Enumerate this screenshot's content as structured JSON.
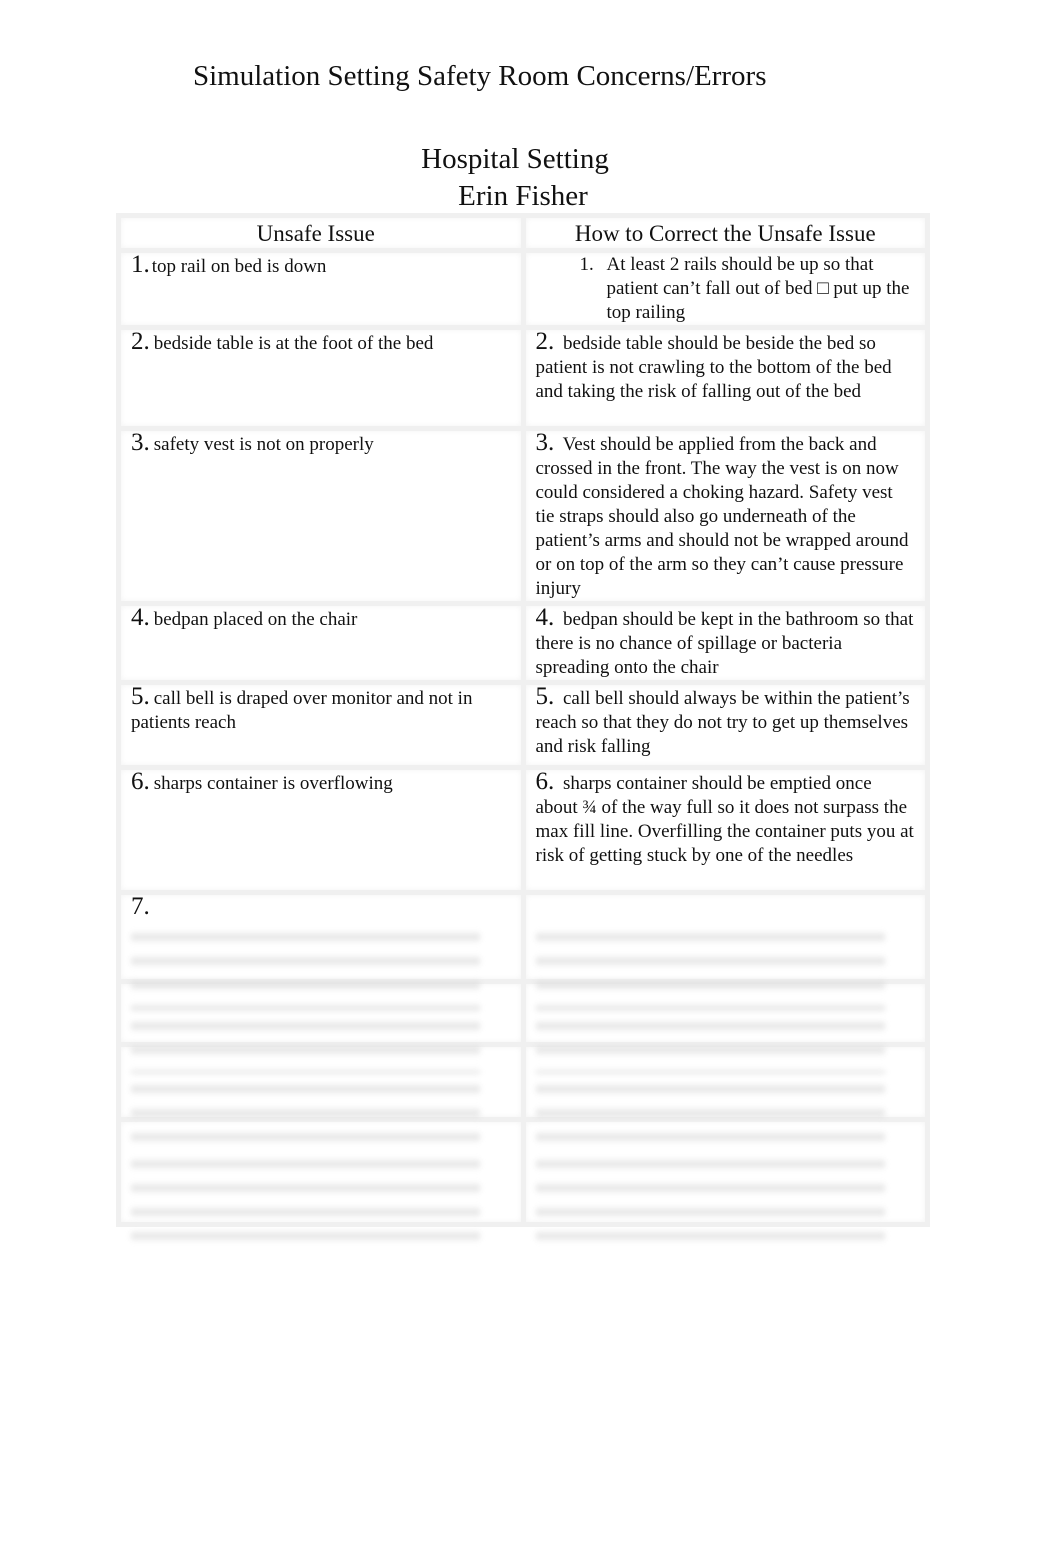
{
  "document": {
    "title": "Simulation Setting Safety Room Concerns/Errors",
    "setting": "Hospital Setting",
    "author": "Erin Fisher"
  },
  "table": {
    "headers": [
      "Unsafe Issue",
      "How to Correct the Unsafe Issue"
    ],
    "rows": [
      {
        "num": "1.",
        "issue": "top rail on bed is down",
        "fix_num": "1.",
        "fix": "At least 2 rails should be up so that patient can’t fall out of bed □   put up the top railing",
        "blurred": false
      },
      {
        "num": "2.",
        "issue": "bedside table is at the foot of the bed",
        "fix_num": "2.",
        "fix": "bedside table should be beside the bed so patient is not crawling to the bottom of the bed and taking the risk of falling out of the bed",
        "blurred": false
      },
      {
        "num": "3.",
        "issue": "safety vest is not on properly",
        "fix_num": "3.",
        "fix": "Vest should be applied from the back and crossed in the front. The way the vest is on now could considered a choking hazard. Safety vest tie straps should also go underneath of the patient’s arms and should not be wrapped around or on top of the arm so they can’t cause pressure injury",
        "blurred": false
      },
      {
        "num": "4.",
        "issue": "bedpan placed on the chair",
        "fix_num": "4.",
        "fix": "bedpan should be kept in the bathroom so that there is no chance of spillage or bacteria spreading onto the chair",
        "blurred": false
      },
      {
        "num": "5.",
        "issue": "call bell is draped over monitor and not in patients reach",
        "fix_num": "5.",
        "fix": "call bell should always be within the patient’s reach so that they do not try to get up themselves and risk falling",
        "blurred": false
      },
      {
        "num": "6.",
        "issue": "sharps container is overflowing",
        "fix_num": "6.",
        "fix": "sharps container should be emptied once about ¾ of the way full so it does not surpass the max fill line. Overfilling the container puts you at risk of getting stuck by one of the needles",
        "blurred": false
      },
      {
        "num": "7.",
        "issue": "",
        "fix_num": "",
        "fix": "",
        "blurred": true
      },
      {
        "num": "",
        "issue": "",
        "fix_num": "",
        "fix": "",
        "blurred": true
      },
      {
        "num": "",
        "issue": "",
        "fix_num": "",
        "fix": "",
        "blurred": true
      },
      {
        "num": "",
        "issue": "",
        "fix_num": "",
        "fix": "",
        "blurred": true
      }
    ]
  }
}
